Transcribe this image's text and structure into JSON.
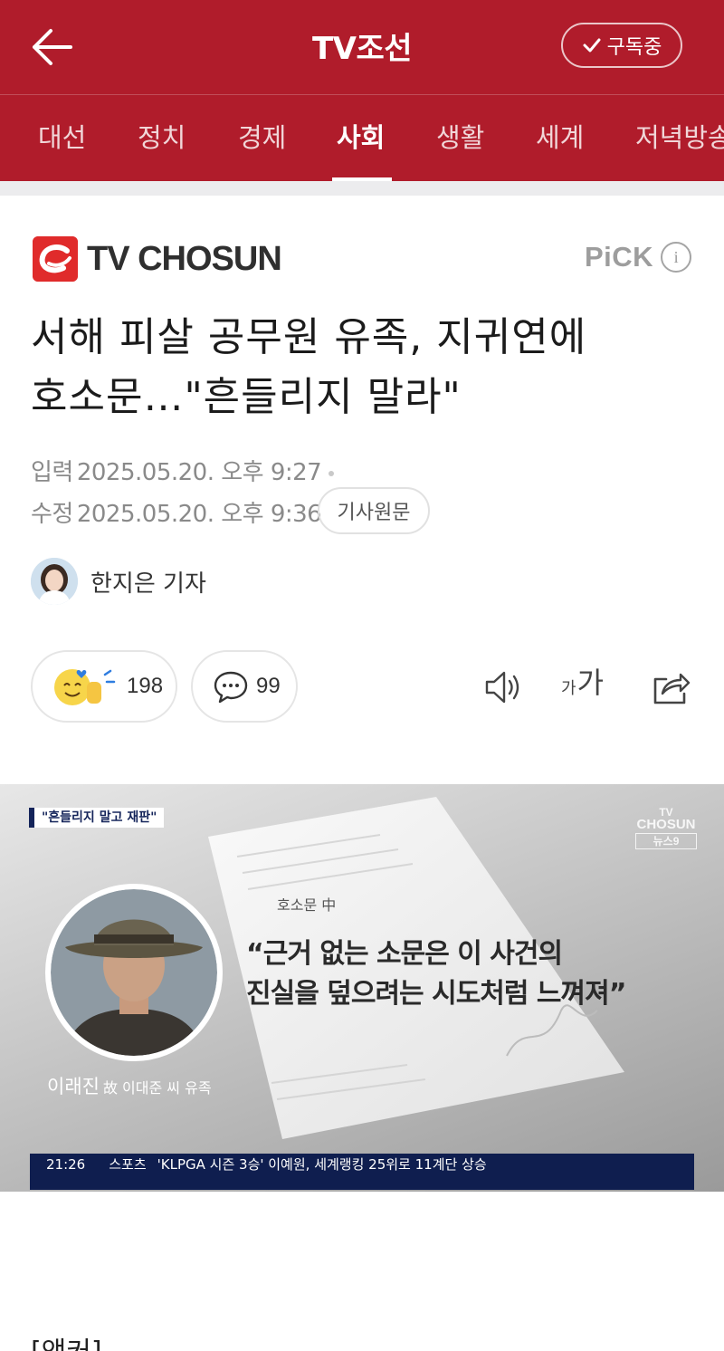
{
  "header": {
    "title": "TV조선",
    "subscribe_label": "구독중",
    "icons": {
      "back": "arrow-left-icon",
      "check": "check-icon"
    }
  },
  "tabs": [
    {
      "label": "대선",
      "active": false
    },
    {
      "label": "정치",
      "active": false
    },
    {
      "label": "경제",
      "active": false
    },
    {
      "label": "사회",
      "active": true
    },
    {
      "label": "생활",
      "active": false
    },
    {
      "label": "세계",
      "active": false
    },
    {
      "label": "저녁방송",
      "active": false
    }
  ],
  "press": {
    "name": "TV CHOSUN",
    "pick_label": "PiCK",
    "info_glyph": "i",
    "brand_color": "#e02b2b"
  },
  "article": {
    "headline_line1": "서해 피살 공무원 유족, 지귀연에",
    "headline_line2": "호소문…\"흔들리지 말라\"",
    "input_label": "입력",
    "input_time": "2025.05.20. 오후 9:27",
    "modified_label": "수정",
    "modified_time": "2025.05.20. 오후 9:36",
    "original_button": "기사원문",
    "reporter": "한지은 기자",
    "reaction_count": "198",
    "comment_count": "99",
    "font_small": "가",
    "font_big": "가",
    "body_start": "[앵커]"
  },
  "news_image": {
    "caption_tag": "\"흔들리지 말고 재판\"",
    "watermark_top": "TV",
    "watermark_mid": "CHOSUN",
    "watermark_bottom": "뉴스9",
    "letter_source": "호소문 中",
    "quote_line1": "“근거 없는 소문은 이 사건의",
    "quote_line2": "진실을 덮으려는 시도처럼 느껴져”",
    "person_name": "이래진",
    "person_relation": "故 이대준 씨 유족",
    "ticker_time": "21:26",
    "ticker_category": "스포츠",
    "ticker_text": "'KLPGA 시즌 3승' 이예원, 세계랭킹 25위로 11계단 상승"
  },
  "colors": {
    "header_red": "#b01c2b",
    "ticker_navy": "#0f1e4f"
  }
}
